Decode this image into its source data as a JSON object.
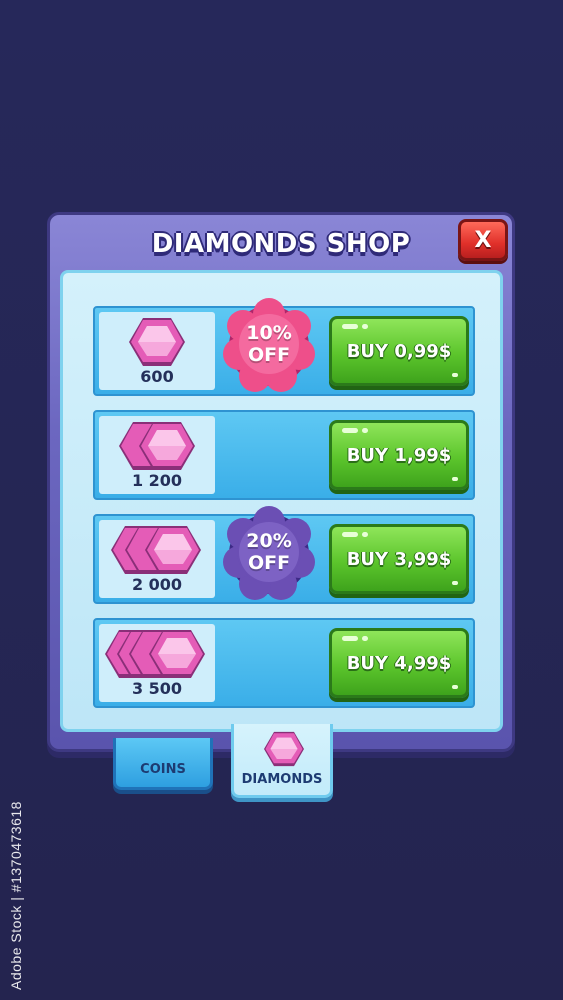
{
  "shop": {
    "title": "DIAMONDS SHOP",
    "close_label": "X"
  },
  "offers": [
    {
      "amount": "600",
      "gem_count": 1,
      "badge": "10%\nOFF",
      "badge_line1": "10%",
      "badge_line2": "OFF",
      "badge_color": "#ee4f8a",
      "buy_label": "BUY 0,99$"
    },
    {
      "amount": "1 200",
      "gem_count": 2,
      "badge_line1": "",
      "badge_line2": "",
      "buy_label": "BUY 1,99$"
    },
    {
      "amount": "2 000",
      "gem_count": 3,
      "badge_line1": "20%",
      "badge_line2": "OFF",
      "badge_color": "#6b4fb4",
      "buy_label": "BUY 3,99$"
    },
    {
      "amount": "3 500",
      "gem_count": 4,
      "badge_line1": "",
      "badge_line2": "",
      "buy_label": "BUY 4,99$"
    }
  ],
  "tabs": [
    {
      "label": "COINS",
      "active": false
    },
    {
      "label": "DIAMONDS",
      "active": true,
      "icon": "diamond-icon"
    }
  ],
  "watermark": "Adobe Stock | #1370473618",
  "colors": {
    "background": "#25264f",
    "panel": "#6c67c0",
    "buy_button": "#5cc52c",
    "close_button": "#e0302a",
    "gem": "#e05bb8"
  }
}
